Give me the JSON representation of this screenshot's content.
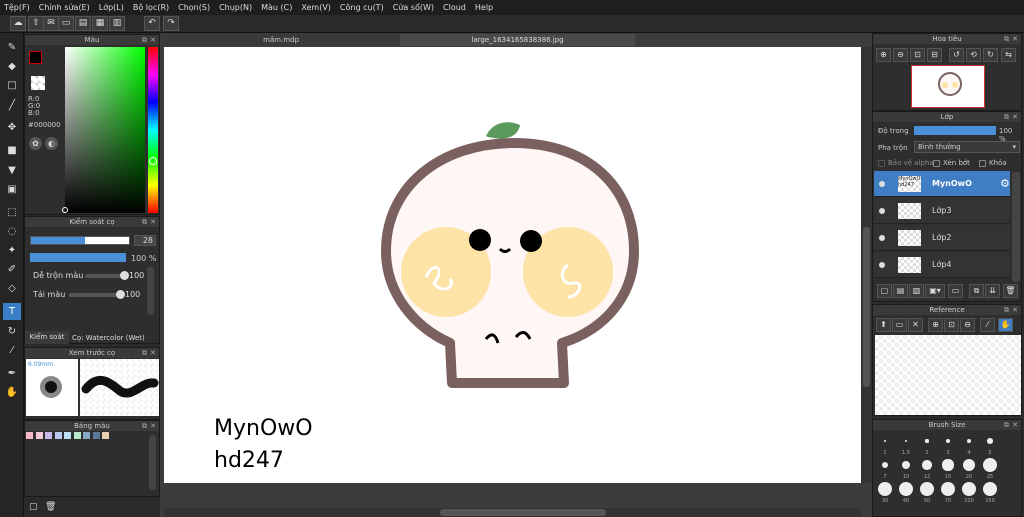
{
  "menu": [
    "Tệp(F)",
    "Chỉnh sửa(E)",
    "Lớp(L)",
    "Bộ lọc(R)",
    "Chọn(S)",
    "Chụp(N)",
    "Màu (C)",
    "Xem(V)",
    "Công cụ(T)",
    "Cửa sổ(W)",
    "Cloud",
    "Help"
  ],
  "tabs": {
    "tab1": "mầm.mdp",
    "tab2": "large_1634165838386.jpg"
  },
  "color_panel": {
    "title": "Màu",
    "r": "R:0",
    "g": "G:0",
    "b": "B:0",
    "hex": "#000000"
  },
  "brush_control": {
    "title": "Kiểm soát cọ",
    "size": "28",
    "opacity": "100 %",
    "mix_label": "Dễ trộn màu",
    "mix_value": "100",
    "paint_label": "Tải màu",
    "paint_value": "100",
    "tab_label": "Kiểm soát cọ",
    "brush_name": "Cọ: Watercolor (Wet)"
  },
  "preview": {
    "title": "Xem trước cọ",
    "size": "6.09mm"
  },
  "palette": {
    "title": "Bảng màu"
  },
  "palette_colors": [
    "#f5b8c4",
    "#f4c7d9",
    "#c9b8e8",
    "#b8c7f0",
    "#b8e0f0",
    "#b8e8c7",
    "#88a8c8",
    "#5a7898",
    "#e8d0b0"
  ],
  "navigator": {
    "title": "Hoa tiêu"
  },
  "layers_panel": {
    "title": "Lớp",
    "opacity_label": "Độ trong",
    "opacity_value": "100 %",
    "blend_label": "Pha trộn",
    "blend_value": "Bình thường",
    "protect_alpha": "Bảo vệ alpha",
    "clipping": "Xén bớt",
    "lock": "Khóa"
  },
  "layers": [
    {
      "name": "MynOwO",
      "thumb": "MynOwO hd247",
      "selected": true
    },
    {
      "name": "Lớp3",
      "thumb": "",
      "selected": false
    },
    {
      "name": "Lớp2",
      "thumb": "",
      "selected": false
    },
    {
      "name": "Lớp4",
      "thumb": "",
      "selected": false
    }
  ],
  "reference": {
    "title": "Reference"
  },
  "brush_size": {
    "title": "Brush Size",
    "labels": [
      "1",
      "1.5",
      "2",
      "3",
      "4",
      "5",
      "7",
      "10",
      "12",
      "15",
      "20",
      "25",
      "30",
      "40",
      "50",
      "70",
      "100",
      "150"
    ]
  },
  "canvas_text": {
    "line1": "MynOwO",
    "line2": "hd247"
  },
  "colors": {
    "accent": "#3f7dc4",
    "outline": "#7a6160",
    "cheek": "#fde3a5",
    "leaf": "#5a9a5a"
  }
}
